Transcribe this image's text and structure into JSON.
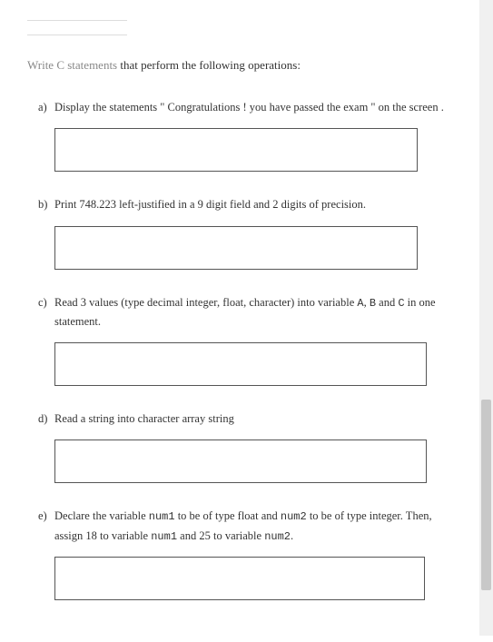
{
  "instruction": {
    "light": "Write C statements",
    "rest": " that perform the following operations:"
  },
  "questions": {
    "a": {
      "label": "a)",
      "text_before": "Display the statements \" Congratulations !   you have passed the exam \"   on the screen ."
    },
    "b": {
      "label": "b)",
      "text": "Print 748.223 left-justified in a 9 digit field and 2 digits of precision."
    },
    "c": {
      "label": "c)",
      "text_before": "Read 3 values (type decimal integer, float, character) into variable ",
      "code1": "A",
      "mid1": ", ",
      "code2": "B",
      "mid2": " and ",
      "code3": "C",
      "text_after": " in one statement."
    },
    "d": {
      "label": "d)",
      "text": " Read a string into character array string"
    },
    "e": {
      "label": "e)",
      "text_before": "Declare the variable ",
      "code1": "num1",
      "mid1": " to be of type float and ",
      "code2": "num2",
      "mid2": " to be of type integer. Then, assign 18 to variable ",
      "code3": "num1",
      "mid3": " and 25 to variable ",
      "code4": "num2",
      "text_after": "."
    }
  }
}
